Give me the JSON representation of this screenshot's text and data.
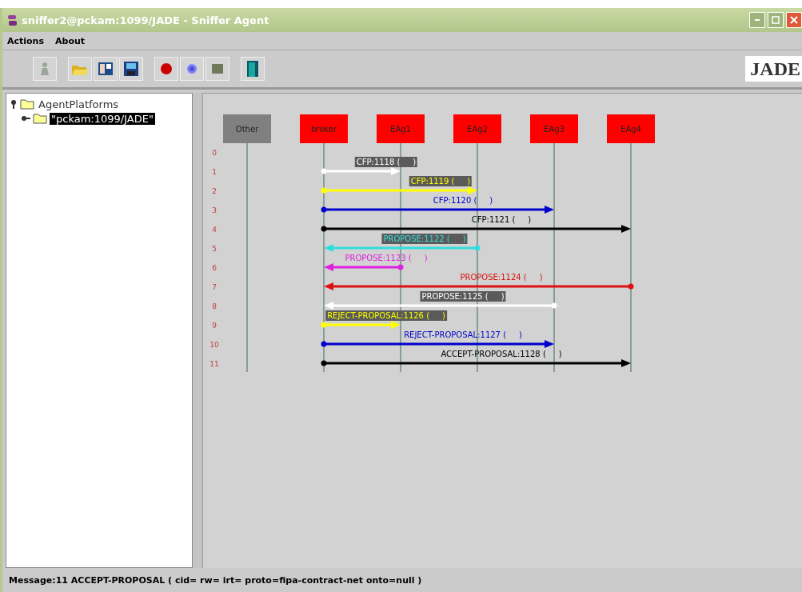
{
  "window": {
    "title": "sniffer2@pckam:1099/JADE - Sniffer Agent"
  },
  "menu": [
    "Actions",
    "About"
  ],
  "toolbar": {
    "logo": "JADE"
  },
  "tree": {
    "label": "AgentPlatforms",
    "expanded": true,
    "children": [
      {
        "label": "\"pckam:1099/JADE\"",
        "selected": true,
        "expanded": false
      }
    ]
  },
  "agents": [
    {
      "name": "Other",
      "color": "#808080"
    },
    {
      "name": "broker",
      "color": "#ff0000"
    },
    {
      "name": "EAg1",
      "color": "#ff0000"
    },
    {
      "name": "EAg2",
      "color": "#ff0000"
    },
    {
      "name": "EAg3",
      "color": "#ff0000"
    },
    {
      "name": "EAg4",
      "color": "#ff0000"
    }
  ],
  "rows": [
    {
      "number": "0"
    },
    {
      "number": "1",
      "message": {
        "label": "CFP:1118 (     )",
        "color": "#ffffff"
      }
    },
    {
      "number": "2",
      "message": {
        "label": "CFP:1119 (     )",
        "color": "#ffff00"
      }
    },
    {
      "number": "3",
      "message": {
        "label": "CFP:1120 (     )",
        "color": "#0000cc"
      }
    },
    {
      "number": "4",
      "message": {
        "label": "CFP:1121 (     )",
        "color": "#000000"
      }
    },
    {
      "number": "5",
      "message": {
        "label": "PROPOSE:1122 (     )",
        "color": "#33dddd"
      }
    },
    {
      "number": "6",
      "message": {
        "label": "PROPOSE:1123 (     )",
        "color": "#dd22dd"
      }
    },
    {
      "number": "7",
      "message": {
        "label": "PROPOSE:1124 (     )",
        "color": "#dd1111"
      }
    },
    {
      "number": "8",
      "message": {
        "label": "PROPOSE:1125 (     )",
        "color": "#ffffff"
      }
    },
    {
      "number": "9",
      "message": {
        "label": "REJECT-PROPOSAL:1126 (     )",
        "color": "#ffff00"
      }
    },
    {
      "number": "10",
      "message": {
        "label": "REJECT-PROPOSAL:1127 (     )",
        "color": "#0000cc"
      }
    },
    {
      "number": "11",
      "message": {
        "label": "ACCEPT-PROPOSAL:1128 (     )",
        "color": "#000000"
      }
    }
  ],
  "status_bar": "Message:11 ACCEPT-PROPOSAL ( cid=  rw=  irt=  proto=fipa-contract-net onto=null )"
}
